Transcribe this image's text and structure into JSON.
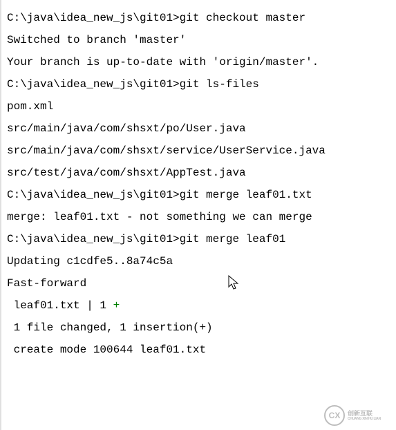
{
  "terminal": {
    "lines": [
      {
        "prompt": "C:\\java\\idea_new_js\\git01>",
        "cmd": "git checkout master"
      },
      {
        "text": "Switched to branch 'master'"
      },
      {
        "text": "Your branch is up-to-date with 'origin/master'."
      },
      {
        "text": ""
      },
      {
        "prompt": "C:\\java\\idea_new_js\\git01>",
        "cmd": "git ls-files"
      },
      {
        "text": "pom.xml"
      },
      {
        "text": "src/main/java/com/shsxt/po/User.java"
      },
      {
        "text": "src/main/java/com/shsxt/service/UserService.java"
      },
      {
        "text": "src/test/java/com/shsxt/AppTest.java"
      },
      {
        "text": ""
      },
      {
        "prompt": "C:\\java\\idea_new_js\\git01>",
        "cmd": "git merge leaf01.txt"
      },
      {
        "text": "merge: leaf01.txt - not something we can merge"
      },
      {
        "text": ""
      },
      {
        "prompt": "C:\\java\\idea_new_js\\git01>",
        "cmd": "git merge leaf01"
      },
      {
        "text": "Updating c1cdfe5..8a74c5a"
      },
      {
        "text": "Fast-forward"
      },
      {
        "text_a": " leaf01.txt | 1 ",
        "plus": "+"
      },
      {
        "text": " 1 file changed, 1 insertion(+)"
      },
      {
        "text": " create mode 100644 leaf01.txt"
      }
    ]
  },
  "watermark": {
    "logo_letter": "CX",
    "line1": "创新互联",
    "line2": "CHUANG XIN HU LIAN"
  }
}
